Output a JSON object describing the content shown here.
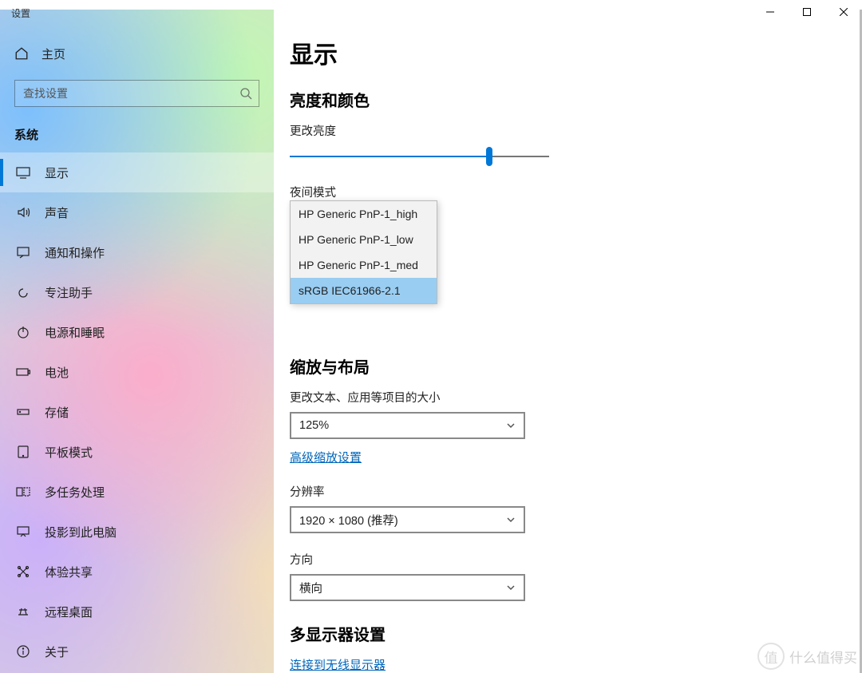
{
  "window": {
    "title": "设置"
  },
  "sidebar": {
    "home": "主页",
    "search_placeholder": "查找设置",
    "group": "系统",
    "items": [
      {
        "label": "显示"
      },
      {
        "label": "声音"
      },
      {
        "label": "通知和操作"
      },
      {
        "label": "专注助手"
      },
      {
        "label": "电源和睡眠"
      },
      {
        "label": "电池"
      },
      {
        "label": "存储"
      },
      {
        "label": "平板模式"
      },
      {
        "label": "多任务处理"
      },
      {
        "label": "投影到此电脑"
      },
      {
        "label": "体验共享"
      },
      {
        "label": "远程桌面"
      },
      {
        "label": "关于"
      }
    ]
  },
  "main": {
    "page_title": "显示",
    "section_brightness": "亮度和颜色",
    "label_change_brightness": "更改亮度",
    "brightness_percent": 77,
    "label_night_mode": "夜间模式",
    "color_profile_options": [
      "HP Generic PnP-1_high",
      "HP Generic PnP-1_low",
      "HP Generic PnP-1_med",
      "sRGB IEC61966-2.1"
    ],
    "color_profile_selected_index": 3,
    "section_scale": "缩放与布局",
    "label_scale": "更改文本、应用等项目的大小",
    "scale_value": "125%",
    "link_advanced_scale": "高级缩放设置",
    "label_resolution": "分辨率",
    "resolution_value": "1920 × 1080 (推荐)",
    "label_orientation": "方向",
    "orientation_value": "横向",
    "section_multi": "多显示器设置",
    "link_wireless": "连接到无线显示器"
  },
  "watermark": "什么值得买"
}
